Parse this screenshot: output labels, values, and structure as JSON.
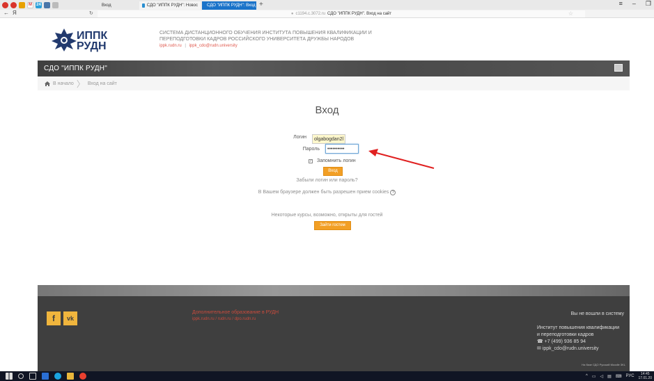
{
  "browser": {
    "tabs": [
      {
        "label": "Вход"
      },
      {
        "label": "СДО \"ИППК РУДН\": Новос"
      },
      {
        "label": "СДО \"ИППК РУДН\": Вход"
      }
    ],
    "new_tab": "+",
    "window_controls": [
      "≡",
      "–",
      "❐"
    ],
    "address_host": "c1194.c.3072.ru",
    "address_title": "СДО \"ИППК РУДН\". Вход на сайт",
    "back": "←",
    "yandex": "Я"
  },
  "site": {
    "logo_line1": "ИППК",
    "logo_line2": "РУДН",
    "desc_line1": "СИСТЕМА ДИСТАНЦИОННОГО ОБУЧЕНИЯ ИНСТИТУТА ПОВЫШЕНИЯ КВАЛИФИКАЦИИ И",
    "desc_line2": "ПЕРЕПОДГОТОВКИ КАДРОВ РОССИЙСКОГО УНИВЕРСИТЕТА ДРУЖБЫ НАРОДОВ",
    "link_site": "ippk.rudn.ru",
    "link_sep": "|",
    "link_mail": "ippk_cdo@rudn.university",
    "nav_title": "СДО \"ИППК РУДН\""
  },
  "breadcrumb": {
    "home": "В начало",
    "current": "Вход на сайт"
  },
  "login": {
    "title": "Вход",
    "username_label": "Логин",
    "username_value": "olgabogdan2l",
    "password_label": "Пароль",
    "password_value": "••••••••••",
    "remember_label": "Запомнить логин",
    "remember_checked": true,
    "submit_label": "Вход",
    "forgot_link": "Забыли логин или пароль?",
    "cookies_note": "В Вашем браузере должен быть разрешен прием cookies",
    "guest_note": "Некоторые курсы, возможно, открыты для гостей",
    "guest_button": "Зайти гостем"
  },
  "footer": {
    "facebook": "f",
    "vk": "vk",
    "middle_title": "Дополнительное образование в РУДН",
    "middle_links": "ippk.rudn.ru  /  rudn.ru  /  dpo.rudn.ru",
    "not_logged": "Вы не вошли в систему",
    "org_line1": "Институт повышения квалификации",
    "org_line2": "и переподготовки кадров",
    "phone": "+7 (499) 936 85 94",
    "email": "ippk_cdo@rudn.university",
    "powered": "На базе СДО Русский Moodle 3KL"
  },
  "taskbar": {
    "lang": "РУС",
    "time": "14:45",
    "date": "17.01.20"
  },
  "colors": {
    "accent_orange": "#f29f25",
    "arrow_red": "#e02020",
    "logo_blue": "#223a6e"
  }
}
